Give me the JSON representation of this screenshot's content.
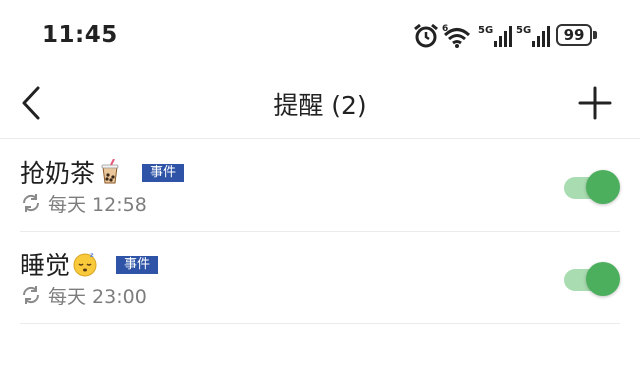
{
  "status_bar": {
    "time": "11:45",
    "icons": [
      "alarm-icon",
      "wifi-icon",
      "signal-5g-icon",
      "signal-5g-icon"
    ],
    "wifi_label": "6",
    "signal1_label": "5G",
    "signal2_label": "5G",
    "battery": "99"
  },
  "header": {
    "back_icon": "chevron-left-icon",
    "title": "提醒 (2)",
    "add_icon": "plus-icon"
  },
  "reminders": [
    {
      "name": "抢奶茶",
      "emoji": "bubble-tea-icon",
      "badge": "事件",
      "repeat": "每天 12:58",
      "enabled": true
    },
    {
      "name": "睡觉",
      "emoji": "sleeping-face-icon",
      "badge": "事件",
      "repeat": "每天 23:00",
      "enabled": true
    }
  ],
  "colors": {
    "badge": "#2f54a7",
    "toggle_on": "#4caf5d",
    "toggle_track": "#a9dcb1",
    "secondary_text": "#7d7d7d"
  }
}
